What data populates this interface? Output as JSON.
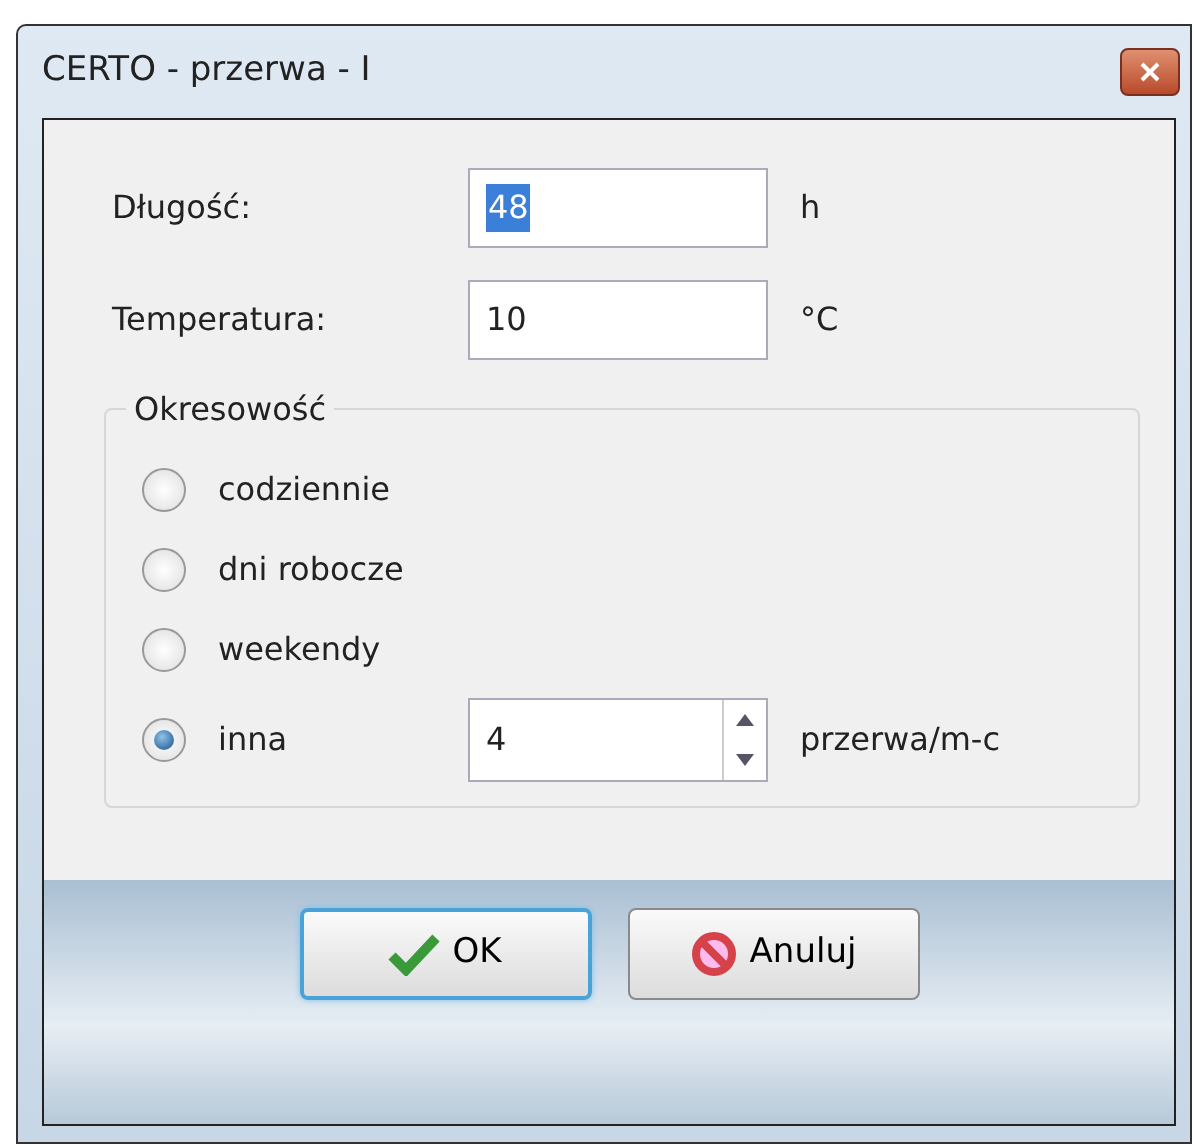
{
  "window": {
    "title": "CERTO - przerwa - I"
  },
  "fields": [
    {
      "label": "Długość:",
      "value": "48",
      "unit": "h",
      "highlighted": true
    },
    {
      "label": "Temperatura:",
      "value": "10",
      "unit": "°C",
      "highlighted": false
    }
  ],
  "periodicity": {
    "legend": "Okresowość",
    "options": [
      {
        "label": "codziennie",
        "selected": false
      },
      {
        "label": "dni robocze",
        "selected": false
      },
      {
        "label": "weekendy",
        "selected": false
      },
      {
        "label": "inna",
        "selected": true,
        "spin_value": "4",
        "unit": "przerwa/m-c"
      }
    ]
  },
  "buttons": [
    {
      "label": "OK",
      "kind": "ok",
      "focused": true
    },
    {
      "label": "Anuluj",
      "kind": "cancel",
      "focused": false
    }
  ]
}
